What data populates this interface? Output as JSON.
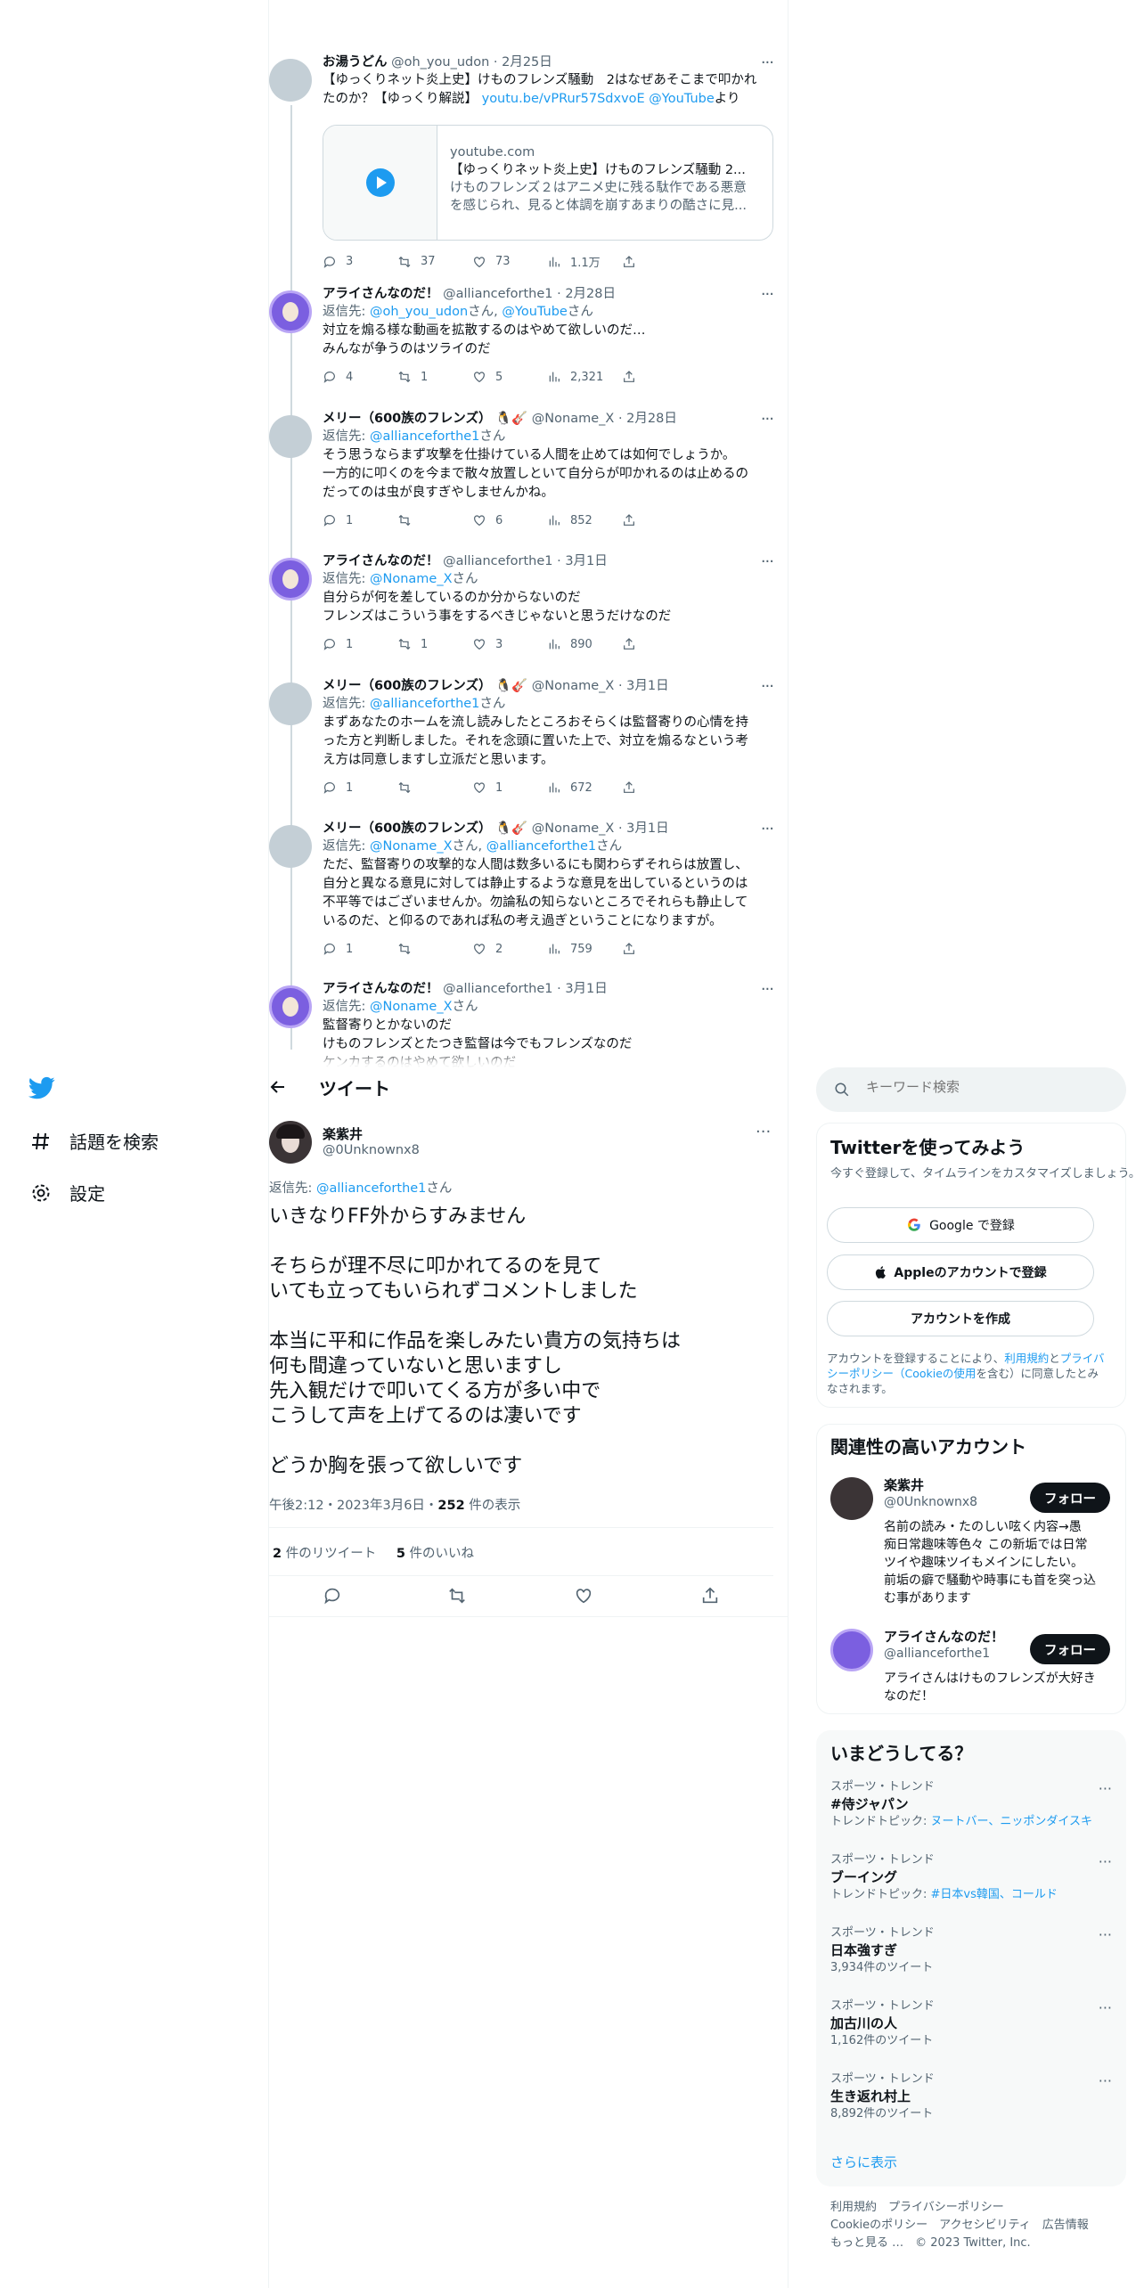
{
  "nav": {
    "explore": "話題を検索",
    "settings": "設定"
  },
  "replies": [
    {
      "name": "お湯うどん",
      "handle": "@oh_you_udon",
      "date": "2月25日",
      "lines": [
        "【ゆっくりネット炎上史】けものフレンズ騒動　2はなぜあそこまで叩かれ",
        "たのか？【ゆっくり解説】"
      ],
      "link1": "youtu.be/vPRur57SdxvoE",
      "link2": "@YouTube",
      "after": "より",
      "reply": "3",
      "rt": "37",
      "like": "73",
      "views": "1.1万"
    },
    {
      "name": "アライさんなのだ！",
      "handle": "@allianceforthe1",
      "date": "2月28日",
      "replyto_pre": "返信先: ",
      "replyto_a": "@oh_you_udon",
      "replyto_mid": "さん, ",
      "replyto_b": "@YouTube",
      "replyto_post": "さん",
      "lines": [
        "対立を煽る様な動画を拡散するのはやめて欲しいのだ…",
        "みんなが争うのはツライのだ"
      ],
      "reply": "4",
      "rt": "1",
      "like": "5",
      "views": "2,321"
    },
    {
      "name": "メリー（600族のフレンズ）",
      "emoji": "🐧🎸",
      "handle": "@Noname_X",
      "date": "2月28日",
      "replyto_pre": "返信先: ",
      "replyto_a": "@allianceforthe1",
      "replyto_post": "さん",
      "lines": [
        "そう思うならまず攻撃を仕掛けている人間を止めては如何でしょうか。",
        "一方的に叩くのを今まで散々放置しといて自分らが叩かれるのは止めるの",
        "だってのは虫が良すぎやしませんかね。"
      ],
      "reply": "1",
      "rt": "",
      "like": "6",
      "views": "852"
    },
    {
      "name": "アライさんなのだ！",
      "handle": "@allianceforthe1",
      "date": "3月1日",
      "replyto_pre": "返信先: ",
      "replyto_a": "@Noname_X",
      "replyto_post": "さん",
      "lines": [
        "自分らが何を差しているのか分からないのだ",
        "フレンズはこういう事をするべきじゃないと思うだけなのだ"
      ],
      "reply": "1",
      "rt": "1",
      "like": "3",
      "views": "890"
    },
    {
      "name": "メリー（600族のフレンズ）",
      "emoji": "🐧🎸",
      "handle": "@Noname_X",
      "date": "3月1日",
      "replyto_pre": "返信先: ",
      "replyto_a": "@allianceforthe1",
      "replyto_post": "さん",
      "lines": [
        "まずあなたのホームを流し読みしたところおそらくは監督寄りの心情を持",
        "った方と判断しました。それを念頭に置いた上で、対立を煽るなという考",
        "え方は同意しますし立派だと思います。"
      ],
      "reply": "1",
      "rt": "",
      "like": "1",
      "views": "672"
    },
    {
      "name": "メリー（600族のフレンズ）",
      "emoji": "🐧🎸",
      "handle": "@Noname_X",
      "date": "3月1日",
      "replyto_pre": "返信先: ",
      "replyto_a": "@Noname_X",
      "replyto_mid": "さん, ",
      "replyto_b": "@allianceforthe1",
      "replyto_post": "さん",
      "lines": [
        "ただ、監督寄りの攻撃的な人間は数多いるにも関わらずそれらは放置し、",
        "自分と異なる意見に対しては静止するような意見を出しているというのは",
        "不平等ではございませんか。勿論私の知らないところでそれらも静止して",
        "いるのだ、と仰るのであれば私の考え過ぎということになりますが。"
      ],
      "reply": "1",
      "rt": "",
      "like": "2",
      "views": "759"
    },
    {
      "name": "アライさんなのだ！",
      "handle": "@allianceforthe1",
      "date": "3月1日",
      "replyto_pre": "返信先: ",
      "replyto_a": "@Noname_X",
      "replyto_post": "さん",
      "lines": [
        "監督寄りとかないのだ",
        "けものフレンズとたつき監督は今でもフレンズなのだ",
        "ケンカするのはやめて欲しいのだ"
      ]
    }
  ],
  "card": {
    "domain": "youtube.com",
    "title": "【ゆっくりネット炎上史】けものフレンズ騒動 2...",
    "desc1": "けものフレンズ２はアニメ史に残る駄作である悪意",
    "desc2": "を感じられ、見ると体調を崩すあまりの酷さに見..."
  },
  "main": {
    "header": "ツイート",
    "name": "楽紫井",
    "handle": "@0Unknownx8",
    "replyto_pre": "返信先: ",
    "replyto_a": "@allianceforthe1",
    "replyto_post": "さん",
    "lines": [
      "いきなりFF外からすみません",
      "",
      "そちらが理不尽に叩かれてるのを見て",
      "いても立ってもいられずコメントしました",
      "",
      "本当に平和に作品を楽しみたい貴方の気持ちは",
      "何も間違っていないと思いますし",
      "先入観だけで叩いてくる方が多い中で",
      "こうして声を上げてるのは凄いです",
      "",
      "どうか胸を張って欲しいです"
    ],
    "time": "午後2:12・2023年3月6日・",
    "views_num": "252",
    "views_label": " 件の表示",
    "rt_num": "2",
    "rt_label": " 件のリツイート",
    "like_num": "5",
    "like_label": " 件のいいね"
  },
  "search": {
    "placeholder": "キーワード検索"
  },
  "signup": {
    "title": "Twitterを使ってみよう",
    "desc": "今すぐ登録して、タイムラインをカスタマイズしましょう。",
    "google": "Google で登録",
    "apple": "Appleのアカウントで登録",
    "create": "アカウントを作成",
    "terms_pre": "アカウントを登録することにより、",
    "terms_link1": "利用規約",
    "terms_mid": "と",
    "terms_link2": "プライバシーポリシー（Cookieの使用",
    "terms_post": "を含む）に同意したとみなされます。"
  },
  "related": {
    "title": "関連性の高いアカウント",
    "follow": "フォロー",
    "accounts": [
      {
        "name": "楽紫井",
        "handle": "@0Unknownx8",
        "bio": [
          "名前の読み・たのしい呟く内容→愚",
          "痴日常趣味等色々 この新垢では日常",
          "ツイや趣味ツイもメインにしたい。",
          "前垢の癖で騒動や時事にも首を突っ込",
          "む事があります"
        ]
      },
      {
        "name": "アライさんなのだ！",
        "handle": "@allianceforthe1",
        "bio": [
          "アライさんはけものフレンズが大好き",
          "なのだ！"
        ]
      }
    ]
  },
  "trends": {
    "title": "いまどうしてる？",
    "more": "さらに表示",
    "items": [
      {
        "cat": "スポーツ・トレンド",
        "name": "#侍ジャパン",
        "sub_pre": "トレンドトピック: ",
        "sub_links": "ヌートバー、ニッポンダイスキ"
      },
      {
        "cat": "スポーツ・トレンド",
        "name": "ブーイング",
        "sub_pre": "トレンドトピック: ",
        "sub_links": "#日本vs韓国、コールド"
      },
      {
        "cat": "スポーツ・トレンド",
        "name": "日本強すぎ",
        "sub_pre": "3,934件のツイート",
        "sub_links": ""
      },
      {
        "cat": "スポーツ・トレンド",
        "name": "加古川の人",
        "sub_pre": "1,162件のツイート",
        "sub_links": ""
      },
      {
        "cat": "スポーツ・トレンド",
        "name": "生き返れ村上",
        "sub_pre": "8,892件のツイート",
        "sub_links": ""
      }
    ]
  },
  "footer": {
    "l1a": "利用規約",
    "l1b": "プライバシーポリシー",
    "l2a": "Cookieのポリシー",
    "l2b": "アクセシビリティ",
    "l2c": "広告情報",
    "l3a": "もっと見る …",
    "l3b": "© 2023 Twitter, Inc."
  },
  "colors": {
    "accent": "#1d9bf0",
    "text": "#0f1419",
    "muted": "#536471"
  }
}
